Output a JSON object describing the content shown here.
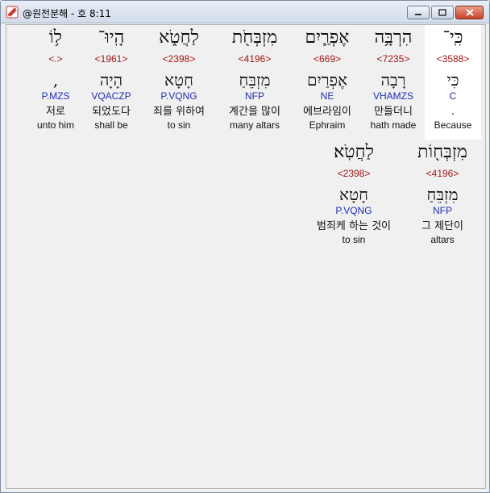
{
  "window": {
    "title": "@원전분해 - 호 8:11"
  },
  "verse_lines": [
    {
      "columns": [
        {
          "word": "כִּֽי־",
          "strong": "<3588>",
          "lemma": "כִּי",
          "morph": "C",
          "korean": ".",
          "english": "Because",
          "highlight": true
        },
        {
          "word": "הִרְבָּ֥ה",
          "strong": "<7235>",
          "lemma": "רָבָה",
          "morph": "VHAMZS",
          "korean": "만들더니",
          "english": "hath made",
          "highlight": false
        },
        {
          "word": "אֶפְרַ֛יִם",
          "strong": "<669>",
          "lemma": "אֶפְרַיִם",
          "morph": "NE",
          "korean": "에브라임이",
          "english": "Ephraim",
          "highlight": false
        },
        {
          "word": "מִזְבְּחֹ֖ת",
          "strong": "<4196>",
          "lemma": "מִזְבֵּחַ",
          "morph": "NFP",
          "korean": "계간을 많이",
          "english": "many altars",
          "highlight": false
        },
        {
          "word": "לַחֲטֹ֑א",
          "strong": "<2398>",
          "lemma": "חָטָא",
          "morph": "P.VQNG",
          "korean": "죄를 위하여",
          "english": "to sin",
          "highlight": false
        },
        {
          "word": "הָֽיוּ־",
          "strong": "<1961>",
          "lemma": "הָיָה",
          "morph": "VQACZP",
          "korean": "되었도다",
          "english": "shall be",
          "highlight": false
        },
        {
          "word": "ל֥וֹ",
          "strong": "<.>",
          "lemma": ",",
          "morph": "P.MZS",
          "korean": "저로",
          "english": "unto him",
          "highlight": false
        }
      ]
    },
    {
      "columns": [
        {
          "word": "מִזְבְּח֖וֹת",
          "strong": "<4196>",
          "lemma": "מִזְבֵּחַ",
          "morph": "NFP",
          "korean": "그 제단이",
          "english": "altars",
          "highlight": false
        },
        {
          "word": "לַחֲטֹֽא׃",
          "strong": "<2398>",
          "lemma": "חָטָא",
          "morph": "P.VQNG",
          "korean": "범죄케 하는 것이",
          "english": "to sin",
          "highlight": false
        }
      ]
    }
  ]
}
